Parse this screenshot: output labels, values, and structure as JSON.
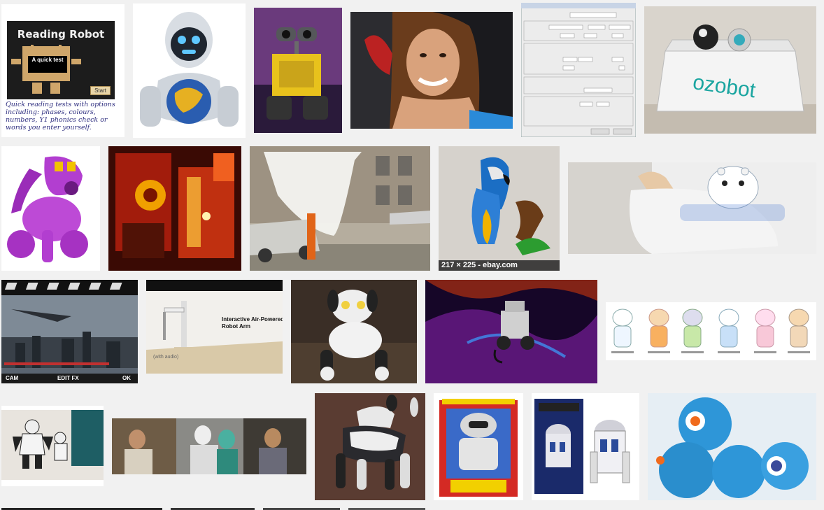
{
  "results": {
    "reading_robot": {
      "title": "Reading Robot",
      "box_text": "A quick test",
      "start": "Start",
      "description": "Quick reading tests with options including: phases, colours, numbers, Y1 phonics check or words you enter yourself."
    },
    "parrot": {
      "caption": "217 × 225 - ebay.com"
    },
    "video_editor": {
      "left": "CAM",
      "center": "EDIT FX",
      "right": "OK"
    },
    "robot_arm": {
      "label": "Interactive Air-Powered Robot Arm",
      "audio": "(with audio)"
    },
    "ozobot": {
      "brand": "ozobot"
    }
  },
  "colors": {
    "page_bg": "#f1f1f1",
    "caption_bg": "#1e1e1e"
  }
}
